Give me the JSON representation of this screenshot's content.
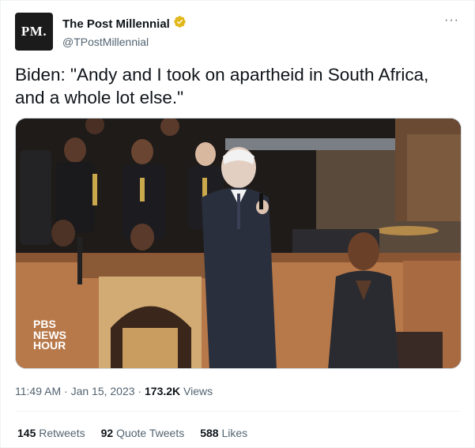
{
  "account": {
    "avatar_text": "PM.",
    "display_name": "The Post Millennial",
    "handle": "@TPostMillennial",
    "verified_icon": "verified-badge-icon",
    "verified_color": "#e2b719"
  },
  "more_label": "···",
  "tweet": {
    "text": "Biden: \"Andy and I took on apartheid in South Africa, and a whole lot else.\""
  },
  "media": {
    "watermark_lines": [
      "PBS",
      "NEWS",
      "HOUR"
    ]
  },
  "meta": {
    "time": "11:49 AM",
    "sep1": " · ",
    "date": "Jan 15, 2023",
    "sep2": " · ",
    "views_count": "173.2K",
    "views_label": " Views"
  },
  "stats": {
    "retweets": {
      "count": "145",
      "label": "Retweets"
    },
    "quotes": {
      "count": "92",
      "label": "Quote Tweets"
    },
    "likes": {
      "count": "588",
      "label": "Likes"
    }
  },
  "colors": {
    "text": "#0f1419",
    "secondary": "#536471",
    "divider": "#eff3f4"
  }
}
